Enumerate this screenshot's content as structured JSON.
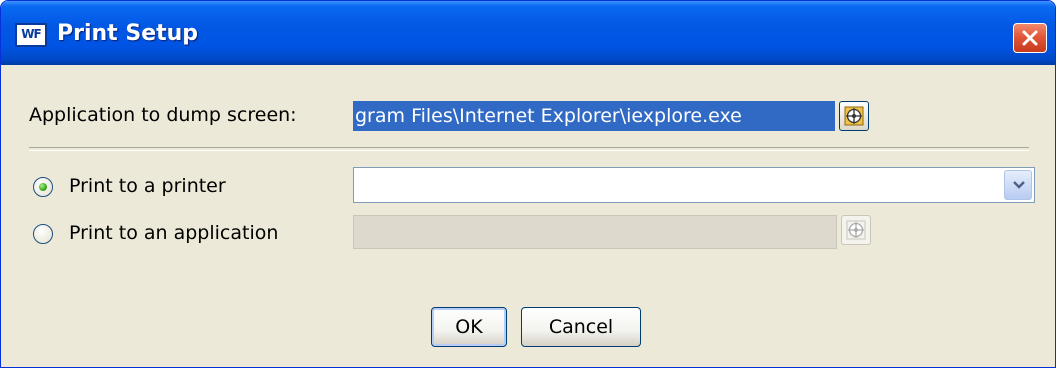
{
  "window": {
    "title": "Print Setup",
    "app_icon_text": "WF",
    "close_label": "Close",
    "colors": {
      "titlebar": "#0054e3",
      "face": "#ece9d8",
      "selection": "#316ac5"
    }
  },
  "dump": {
    "label": "Application to dump screen:",
    "value": "gram Files\\Internet Explorer\\iexplore.exe",
    "browse_icon": "target-browse-icon"
  },
  "print_options": {
    "printer": {
      "label": "Print to a printer",
      "selected": true,
      "dropdown_value": ""
    },
    "application": {
      "label": "Print to an application",
      "selected": false,
      "value": ""
    }
  },
  "buttons": {
    "ok": "OK",
    "cancel": "Cancel"
  }
}
